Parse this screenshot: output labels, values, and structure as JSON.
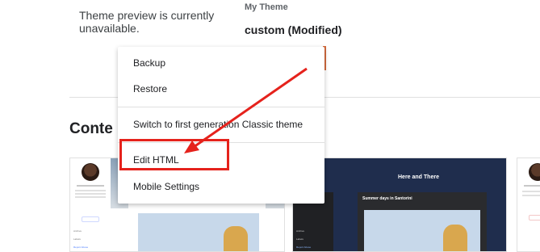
{
  "preview": {
    "message": "Theme preview is currently unavailable.",
    "theme_label": "My Theme",
    "theme_name": "custom (Modified)"
  },
  "content_section": {
    "title": "Conte"
  },
  "context_menu": {
    "items": [
      {
        "label": "Backup"
      },
      {
        "label": "Restore"
      },
      {
        "label": "Switch to first generation Classic theme"
      },
      {
        "label": "Edit HTML"
      },
      {
        "label": "Mobile Settings"
      }
    ]
  },
  "theme_cards": [
    {
      "kind": "light",
      "sidebar_labels": [
        "Archive",
        "Labels",
        "Report Abuse"
      ]
    },
    {
      "kind": "dark",
      "blog_title": "Here and There",
      "post_title": "Summer days in Santorini",
      "sidebar_labels": [
        "Archive",
        "Labels",
        "Report Abuse"
      ]
    },
    {
      "kind": "light-partial"
    }
  ],
  "annotation": {
    "color": "#e5221c"
  }
}
